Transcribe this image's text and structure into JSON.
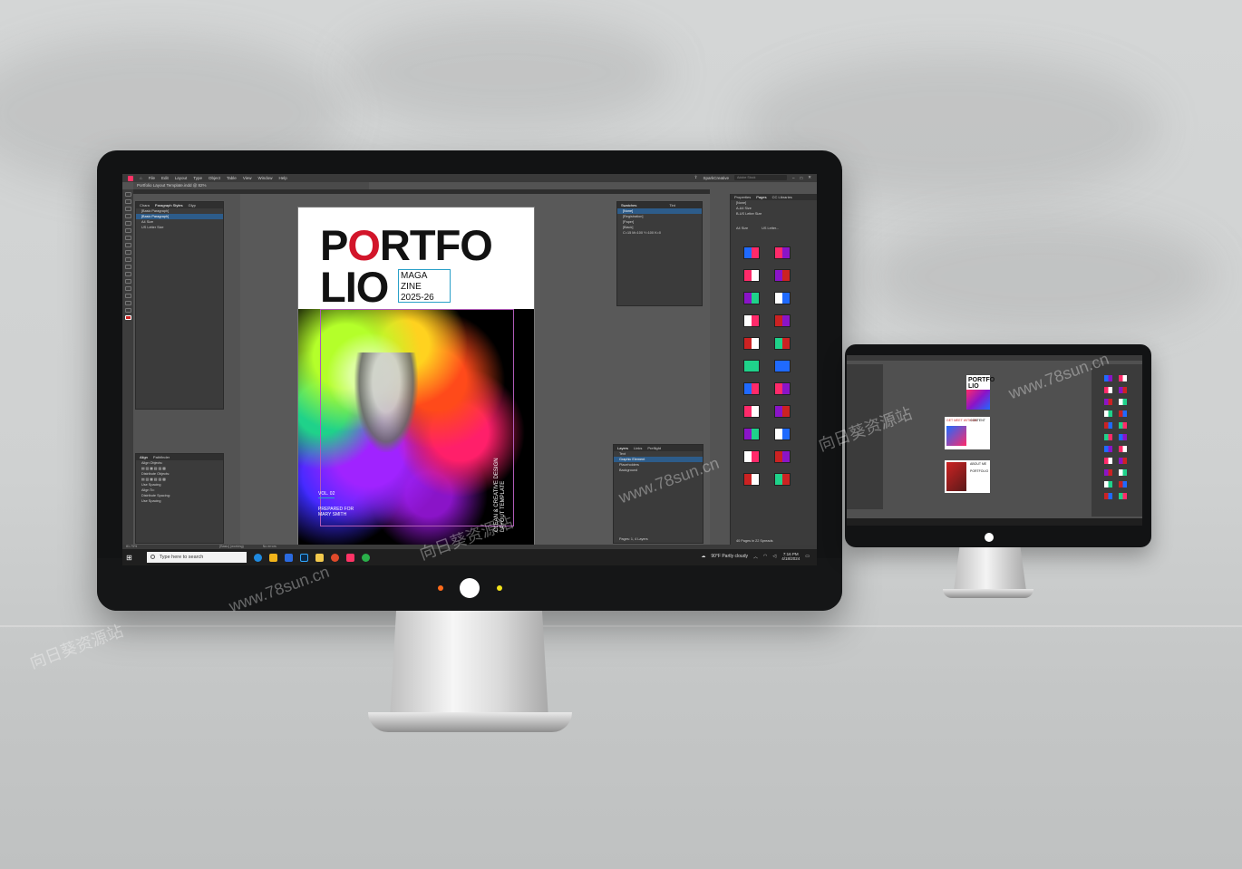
{
  "app": {
    "menu": [
      "File",
      "Edit",
      "Layout",
      "Type",
      "Object",
      "Table",
      "View",
      "Window",
      "Help"
    ],
    "workspace": "SparkCreative",
    "search_placeholder": "Adobe Stock",
    "doc_tab": "Portfolio Layout Template.indd @ 82%"
  },
  "panels": {
    "paragraph_styles": {
      "tabs": [
        "Chara",
        "Paragraph Styles",
        "Glyp"
      ],
      "rows": [
        "[Basic Paragraph]",
        "[Basic Paragraph]",
        "A4 Size",
        "US Letter Size"
      ]
    },
    "align": {
      "tabs": [
        "Align",
        "Pathfinder"
      ],
      "sections": [
        "Align Objects:",
        "Distribute Objects:",
        "Use Spacing",
        "Align To:",
        "Distribute Spacing:",
        "Use Spacing"
      ]
    },
    "swatches": {
      "title": "Swatches",
      "tint": "Tint",
      "rows": [
        "[None]",
        "[Registration]",
        "[Paper]",
        "[Black]",
        "C=15 M=100 Y=100 K=0"
      ]
    },
    "layers": {
      "tabs": [
        "Layers",
        "Links",
        "Preflight"
      ],
      "rows": [
        "Text",
        "Graphic Element",
        "Placeholders",
        "Background"
      ],
      "footer": "Pages: 1, 4 Layers"
    },
    "pages": {
      "tabs": [
        "Properties",
        "Pages",
        "CC Libraries"
      ],
      "masters": [
        "[None]",
        "A-A4 Size",
        "B-US Letter Size"
      ],
      "sections": [
        "A4 Size",
        "US Letter..."
      ],
      "footer": "40 Pages in 22 Spreads"
    }
  },
  "status": {
    "zoom": "81.75%",
    "style": "[Basic] (working)",
    "errors": "No errors"
  },
  "document": {
    "title_line1_a": "P",
    "title_line1_o": "O",
    "title_line1_b": "RTFO",
    "title_line2": "LIO",
    "sub1": "MAGA",
    "sub2": "ZINE",
    "sub3": "2025-26",
    "vol": "VOL. 02",
    "prepared_for": "PREPARED FOR",
    "name": "MARY SMITH",
    "vertical_1": "CLEAN & CREATIVE DESIGN",
    "vertical_2": "LAYOUT TEMPLATE"
  },
  "taskbar": {
    "search_placeholder": "Type here to search",
    "weather": "90°F  Partly cloudy",
    "time": "7:16 PM",
    "date": "4/18/2024"
  },
  "small_screen": {
    "cover_title": "PORTFO LIO",
    "page2_title": "GET MEET WITH ME",
    "page2_sub": "CONTENT",
    "page3_title": "ABOUT ME",
    "page3_sub": "PORTFOLIO"
  },
  "watermarks": [
    "向日葵资源站",
    "www.78sun.cn"
  ],
  "colors": {
    "accent_red": "#d2152a",
    "selection_blue": "#2d5c8a",
    "frame_cyan": "#2aa0c8"
  }
}
